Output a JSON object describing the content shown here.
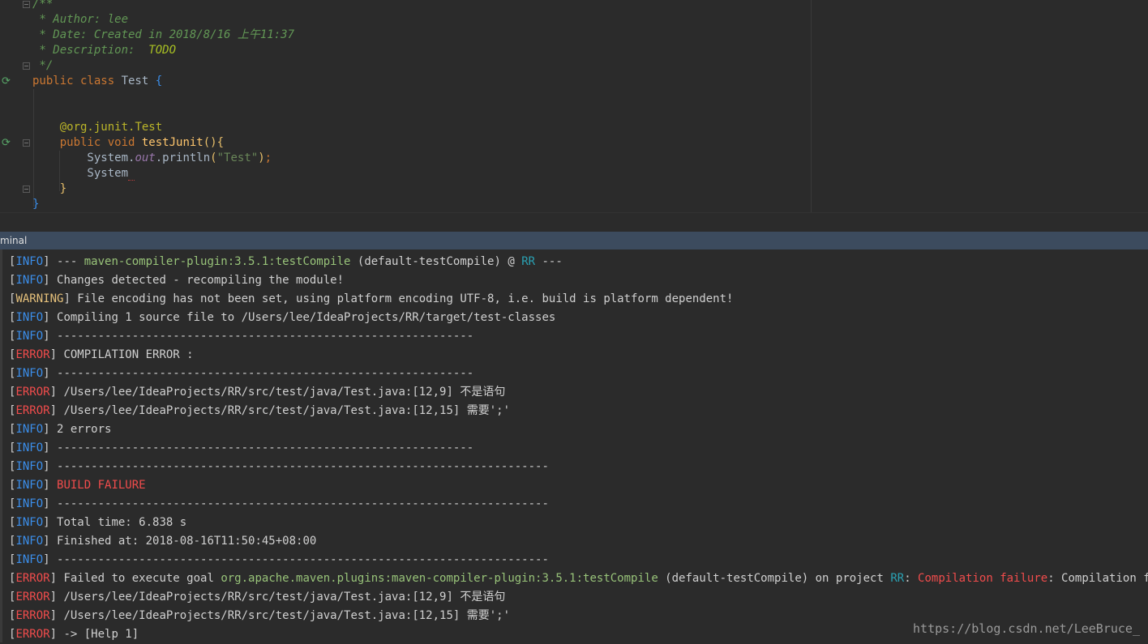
{
  "editor": {
    "lines": [
      {
        "id": "l1",
        "parts": [
          {
            "c": "cmt",
            "t": "/**"
          }
        ]
      },
      {
        "id": "l2",
        "parts": [
          {
            "c": "cmt",
            "t": " * Author: lee"
          }
        ]
      },
      {
        "id": "l3",
        "parts": [
          {
            "c": "cmt",
            "t": " * Date: Created in 2018/8/16 上午11:37"
          }
        ]
      },
      {
        "id": "l4",
        "parts": [
          {
            "c": "cmt",
            "t": " * Description:  "
          },
          {
            "c": "todo",
            "t": "TODO"
          }
        ]
      },
      {
        "id": "l5",
        "parts": [
          {
            "c": "cmt",
            "t": " */"
          }
        ]
      },
      {
        "id": "l6",
        "parts": [
          {
            "c": "kw",
            "t": "public class "
          },
          {
            "c": "",
            "t": "Test "
          },
          {
            "c": "br",
            "t": "{"
          }
        ]
      },
      {
        "id": "l7",
        "parts": []
      },
      {
        "id": "l8",
        "parts": []
      },
      {
        "id": "l9",
        "parts": [
          {
            "c": "",
            "t": "    "
          },
          {
            "c": "ann",
            "t": "@org.junit."
          },
          {
            "c": "ann",
            "t": "Test"
          }
        ]
      },
      {
        "id": "l10",
        "parts": [
          {
            "c": "",
            "t": "    "
          },
          {
            "c": "kw",
            "t": "public void "
          },
          {
            "c": "fn",
            "t": "testJunit"
          },
          {
            "c": "brg",
            "t": "(){"
          }
        ]
      },
      {
        "id": "l11",
        "parts": [
          {
            "c": "",
            "t": "        System."
          },
          {
            "c": "fld",
            "t": "out"
          },
          {
            "c": "",
            "t": ".println"
          },
          {
            "c": "brg",
            "t": "("
          },
          {
            "c": "str",
            "t": "\"Test\""
          },
          {
            "c": "brg",
            "t": ")"
          },
          {
            "c": "kw",
            "t": ";"
          }
        ]
      },
      {
        "id": "l12",
        "parts": [
          {
            "c": "",
            "t": "        System"
          },
          {
            "c": "err-squig",
            "t": " "
          }
        ]
      },
      {
        "id": "l13",
        "parts": [
          {
            "c": "",
            "t": "    "
          },
          {
            "c": "brg",
            "t": "}"
          }
        ]
      },
      {
        "id": "l14",
        "parts": [
          {
            "c": "br",
            "t": "}"
          }
        ]
      }
    ]
  },
  "terminal": {
    "tab_label": "minal",
    "lines": [
      [
        {
          "c": "",
          "t": "["
        },
        {
          "c": "t-info",
          "t": "INFO"
        },
        {
          "c": "",
          "t": "] --- "
        },
        {
          "c": "t-green",
          "t": "maven-compiler-plugin:3.5.1:testCompile"
        },
        {
          "c": "",
          "t": " (default-testCompile) @ "
        },
        {
          "c": "t-cyan",
          "t": "RR"
        },
        {
          "c": "",
          "t": " ---"
        }
      ],
      [
        {
          "c": "",
          "t": "["
        },
        {
          "c": "t-info",
          "t": "INFO"
        },
        {
          "c": "",
          "t": "] Changes detected - recompiling the module!"
        }
      ],
      [
        {
          "c": "",
          "t": "["
        },
        {
          "c": "t-warn",
          "t": "WARNING"
        },
        {
          "c": "",
          "t": "] File encoding has not been set, using platform encoding UTF-8, i.e. build is platform dependent!"
        }
      ],
      [
        {
          "c": "",
          "t": "["
        },
        {
          "c": "t-info",
          "t": "INFO"
        },
        {
          "c": "",
          "t": "] Compiling 1 source file to /Users/lee/IdeaProjects/RR/target/test-classes"
        }
      ],
      [
        {
          "c": "",
          "t": "["
        },
        {
          "c": "t-info",
          "t": "INFO"
        },
        {
          "c": "",
          "t": "] -------------------------------------------------------------"
        }
      ],
      [
        {
          "c": "",
          "t": "["
        },
        {
          "c": "t-err",
          "t": "ERROR"
        },
        {
          "c": "",
          "t": "] COMPILATION ERROR :"
        }
      ],
      [
        {
          "c": "",
          "t": "["
        },
        {
          "c": "t-info",
          "t": "INFO"
        },
        {
          "c": "",
          "t": "] -------------------------------------------------------------"
        }
      ],
      [
        {
          "c": "",
          "t": "["
        },
        {
          "c": "t-err",
          "t": "ERROR"
        },
        {
          "c": "",
          "t": "] /Users/lee/IdeaProjects/RR/src/test/java/Test.java:[12,9] 不是语句"
        }
      ],
      [
        {
          "c": "",
          "t": "["
        },
        {
          "c": "t-err",
          "t": "ERROR"
        },
        {
          "c": "",
          "t": "] /Users/lee/IdeaProjects/RR/src/test/java/Test.java:[12,15] 需要';'"
        }
      ],
      [
        {
          "c": "",
          "t": "["
        },
        {
          "c": "t-info",
          "t": "INFO"
        },
        {
          "c": "",
          "t": "] 2 errors"
        }
      ],
      [
        {
          "c": "",
          "t": "["
        },
        {
          "c": "t-info",
          "t": "INFO"
        },
        {
          "c": "",
          "t": "] -------------------------------------------------------------"
        }
      ],
      [
        {
          "c": "",
          "t": "["
        },
        {
          "c": "t-info",
          "t": "INFO"
        },
        {
          "c": "",
          "t": "] ------------------------------------------------------------------------"
        }
      ],
      [
        {
          "c": "",
          "t": "["
        },
        {
          "c": "t-info",
          "t": "INFO"
        },
        {
          "c": "",
          "t": "] "
        },
        {
          "c": "t-red",
          "t": "BUILD FAILURE"
        }
      ],
      [
        {
          "c": "",
          "t": "["
        },
        {
          "c": "t-info",
          "t": "INFO"
        },
        {
          "c": "",
          "t": "] ------------------------------------------------------------------------"
        }
      ],
      [
        {
          "c": "",
          "t": "["
        },
        {
          "c": "t-info",
          "t": "INFO"
        },
        {
          "c": "",
          "t": "] Total time: 6.838 s"
        }
      ],
      [
        {
          "c": "",
          "t": "["
        },
        {
          "c": "t-info",
          "t": "INFO"
        },
        {
          "c": "",
          "t": "] Finished at: 2018-08-16T11:50:45+08:00"
        }
      ],
      [
        {
          "c": "",
          "t": "["
        },
        {
          "c": "t-info",
          "t": "INFO"
        },
        {
          "c": "",
          "t": "] ------------------------------------------------------------------------"
        }
      ],
      [
        {
          "c": "",
          "t": "["
        },
        {
          "c": "t-err",
          "t": "ERROR"
        },
        {
          "c": "",
          "t": "] Failed to execute goal "
        },
        {
          "c": "t-green",
          "t": "org.apache.maven.plugins:maven-compiler-plugin:3.5.1:testCompile"
        },
        {
          "c": "",
          "t": " (default-testCompile) on project "
        },
        {
          "c": "t-cyan",
          "t": "RR"
        },
        {
          "c": "",
          "t": ": "
        },
        {
          "c": "t-red",
          "t": "Compilation failure"
        },
        {
          "c": "",
          "t": ": Compilation failure:"
        }
      ],
      [
        {
          "c": "",
          "t": "["
        },
        {
          "c": "t-err",
          "t": "ERROR"
        },
        {
          "c": "",
          "t": "] /Users/lee/IdeaProjects/RR/src/test/java/Test.java:[12,9] 不是语句"
        }
      ],
      [
        {
          "c": "",
          "t": "["
        },
        {
          "c": "t-err",
          "t": "ERROR"
        },
        {
          "c": "",
          "t": "] /Users/lee/IdeaProjects/RR/src/test/java/Test.java:[12,15] 需要';'"
        }
      ],
      [
        {
          "c": "",
          "t": "["
        },
        {
          "c": "t-err",
          "t": "ERROR"
        },
        {
          "c": "",
          "t": "] -> [Help 1]"
        }
      ]
    ]
  },
  "watermark": "https://blog.csdn.net/LeeBruce_",
  "icons": {
    "run": "run-test-icon",
    "fold": "fold-icon"
  }
}
